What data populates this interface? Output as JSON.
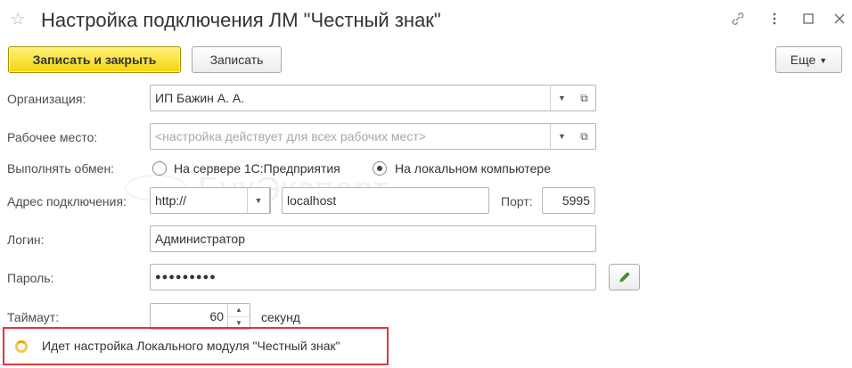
{
  "window": {
    "title": "Настройка подключения ЛМ \"Честный знак\"",
    "favorite_icon": "star-icon",
    "controls": [
      "link-icon",
      "more-vertical-icon",
      "maximize-icon",
      "close-icon"
    ]
  },
  "toolbar": {
    "save_close_label": "Записать и закрыть",
    "save_label": "Записать",
    "more_label": "Еще"
  },
  "form": {
    "organization": {
      "label": "Организация:",
      "value": "ИП Бажин А. А."
    },
    "workplace": {
      "label": "Рабочее место:",
      "placeholder": "<настройка действует для всех рабочих мест>"
    },
    "exchange": {
      "label": "Выполнять обмен:",
      "options": [
        "На сервере 1С:Предприятия",
        "На локальном компьютере"
      ],
      "selected": "На локальном компьютере"
    },
    "address": {
      "label": "Адрес подключения:",
      "protocol": "http://",
      "host": "localhost",
      "port_label": "Порт:",
      "port": "5995"
    },
    "login": {
      "label": "Логин:",
      "value": "Администратор"
    },
    "password": {
      "label": "Пароль:",
      "value": "●●●●●●●●●"
    },
    "timeout": {
      "label": "Таймаут:",
      "value": "60",
      "unit": "секунд"
    }
  },
  "status": {
    "text": "Идет настройка Локального модуля \"Честный знак\""
  },
  "watermark": "БухЭксперт",
  "colors": {
    "primary_button": "#f5d40a",
    "status_border": "#e0343b",
    "loader": "#f2c94c"
  }
}
